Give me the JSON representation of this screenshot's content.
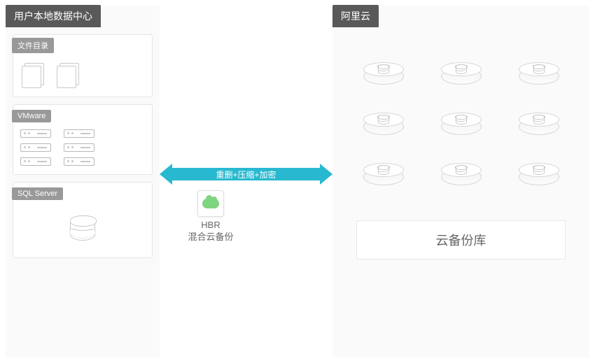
{
  "left_panel": {
    "title": "用户本地数据中心",
    "sections": {
      "files": {
        "label": "文件目录"
      },
      "vmware": {
        "label": "VMware"
      },
      "sql": {
        "label": "SQL Server"
      }
    }
  },
  "right_panel": {
    "title": "阿里云",
    "vault_label": "云备份库"
  },
  "arrow": {
    "label": "重删+压缩+加密"
  },
  "hbr": {
    "name": "HBR",
    "subtitle": "混合云备份"
  }
}
